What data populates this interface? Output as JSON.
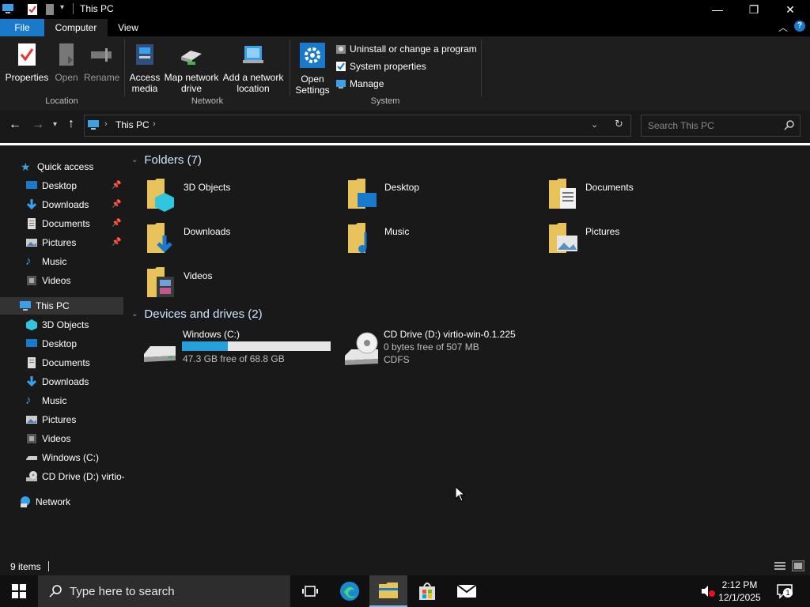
{
  "window": {
    "title": "This PC",
    "minimize_glyph": "—",
    "maximize_glyph": "❐",
    "close_glyph": "✕"
  },
  "ribbon": {
    "tabs": [
      "File",
      "Computer",
      "View"
    ],
    "location": {
      "label": "Location",
      "buttons": [
        "Properties",
        "Open",
        "Rename"
      ]
    },
    "network": {
      "label": "Network",
      "access_media": "Access media",
      "map_network_drive": "Map network drive",
      "add_network_location": "Add a network location"
    },
    "system": {
      "label": "System",
      "open_settings": "Open Settings",
      "uninstall": "Uninstall or change a program",
      "system_properties": "System properties",
      "manage": "Manage"
    }
  },
  "address": {
    "breadcrumb": "This PC",
    "search_placeholder": "Search This PC"
  },
  "nav": {
    "quick_access": "Quick access",
    "quick_items": [
      "Desktop",
      "Downloads",
      "Documents",
      "Pictures",
      "Music",
      "Videos"
    ],
    "this_pc": "This PC",
    "pc_items": [
      "3D Objects",
      "Desktop",
      "Documents",
      "Downloads",
      "Music",
      "Pictures",
      "Videos",
      "Windows (C:)",
      "CD Drive (D:) virtio-"
    ],
    "network": "Network"
  },
  "content": {
    "folders_header": "Folders (7)",
    "folders": [
      "3D Objects",
      "Desktop",
      "Documents",
      "Downloads",
      "Music",
      "Pictures",
      "Videos"
    ],
    "drives_header": "Devices and drives (2)",
    "drives": [
      {
        "name": "Windows (C:)",
        "detail": "47.3 GB free of 68.8 GB",
        "used_fraction": 0.31
      },
      {
        "name": "CD Drive (D:) virtio-win-0.1.225",
        "detail": "0 bytes free of 507 MB",
        "fs": "CDFS"
      }
    ]
  },
  "status": {
    "items_count": "9 items"
  },
  "taskbar": {
    "search_placeholder": "Type here to search",
    "time": "2:12 PM",
    "date": "12/1/2025",
    "notification_count": "1"
  },
  "colors": {
    "accent": "#0078d7",
    "folder_yellow": "#e8c25a",
    "drive_bar": "#26a0da"
  }
}
